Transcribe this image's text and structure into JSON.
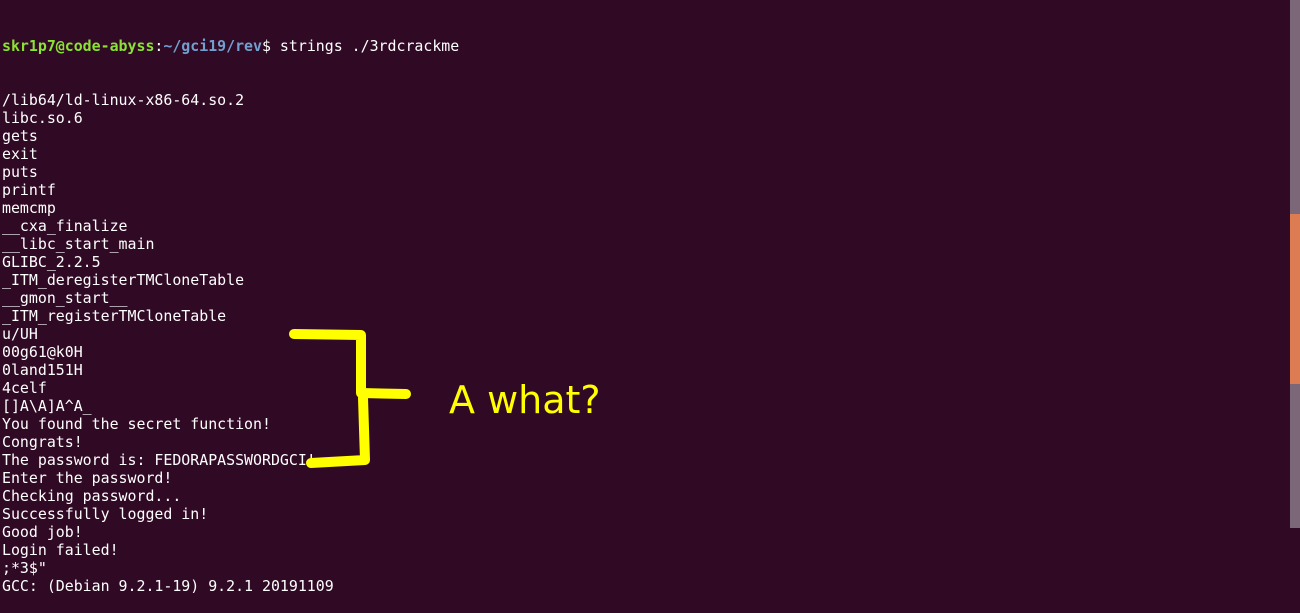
{
  "prompt": {
    "user_host": "skr1p7@code-abyss",
    "colon": ":",
    "path": "~/gci19/rev",
    "symbol": "$",
    "command": " strings ./3rdcrackme"
  },
  "output_lines": [
    "/lib64/ld-linux-x86-64.so.2",
    "libc.so.6",
    "gets",
    "exit",
    "puts",
    "printf",
    "memcmp",
    "__cxa_finalize",
    "__libc_start_main",
    "GLIBC_2.2.5",
    "_ITM_deregisterTMCloneTable",
    "__gmon_start__",
    "_ITM_registerTMCloneTable",
    "u/UH",
    "00g61@k0H",
    "0land151H",
    "4celf",
    "[]A\\A]A^A_",
    "You found the secret function!",
    "Congrats!",
    "The password is: FEDORAPASSWORDGCI!",
    "Enter the password!",
    "Checking password...",
    "Successfully logged in!",
    "Good job!",
    "Login failed!",
    ";*3$\"",
    "GCC: (Debian 9.2.1-19) 9.2.1 20191109"
  ],
  "annotation": {
    "text": "A what?",
    "color": "#ffff00"
  },
  "colors": {
    "background": "#300a24",
    "user": "#8ae234",
    "path": "#729fcf",
    "scrollbar_thumb": "#dd7b52",
    "scrollbar_track": "#7b6778"
  },
  "scroll": {
    "position_percent": 46
  }
}
